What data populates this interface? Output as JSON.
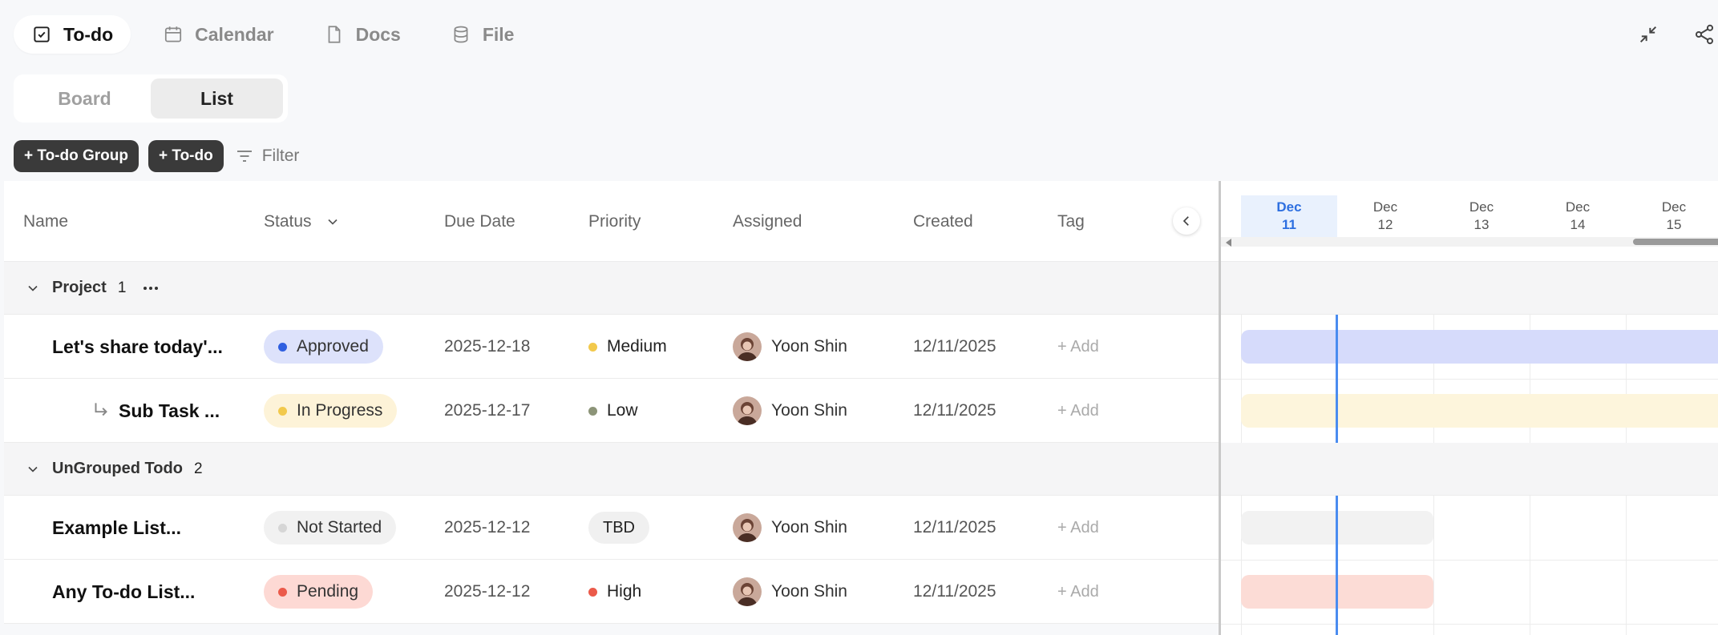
{
  "top_tabs": [
    {
      "label": "To-do",
      "icon": "checkbox-icon",
      "active": true
    },
    {
      "label": "Calendar",
      "icon": "calendar-icon",
      "active": false
    },
    {
      "label": "Docs",
      "icon": "document-icon",
      "active": false
    },
    {
      "label": "File",
      "icon": "database-icon",
      "active": false
    }
  ],
  "top_actions": [
    {
      "icon": "minimize-icon"
    },
    {
      "icon": "share-icon"
    }
  ],
  "view_toggle": {
    "board": "Board",
    "list": "List",
    "active": "List"
  },
  "toolbar": {
    "add_group": "+ To-do Group",
    "add_todo": "+ To-do",
    "filter": "Filter"
  },
  "columns": {
    "name": "Name",
    "status": "Status",
    "due_date": "Due Date",
    "priority": "Priority",
    "assigned": "Assigned",
    "created": "Created",
    "tag": "Tag"
  },
  "groups": [
    {
      "name": "Project",
      "count": "1",
      "rows": [
        {
          "name": "Let's share today'...",
          "subtask": false,
          "status": "Approved",
          "status_dot": "#2f5fe0",
          "status_bg": "#dde2fb",
          "due": "2025-12-18",
          "priority": "Medium",
          "priority_dot": "#f2c94c",
          "priority_style": "dot",
          "assignee": "Yoon Shin",
          "created": "12/11/2025",
          "tag": "+ Add"
        },
        {
          "name": "Sub Task ...",
          "subtask": true,
          "status": "In Progress",
          "status_dot": "#f2c94c",
          "status_bg": "#fdf3d8",
          "due": "2025-12-17",
          "priority": "Low",
          "priority_dot": "#8c9478",
          "priority_style": "dot",
          "assignee": "Yoon Shin",
          "created": "12/11/2025",
          "tag": "+ Add"
        }
      ]
    },
    {
      "name": "UnGrouped Todo",
      "count": "2",
      "rows": [
        {
          "name": "Example List...",
          "subtask": false,
          "status": "Not Started",
          "status_dot": "#d6d6d6",
          "status_bg": "#f1f1f1",
          "due": "2025-12-12",
          "priority": "TBD",
          "priority_dot": "",
          "priority_style": "pill",
          "assignee": "Yoon Shin",
          "created": "12/11/2025",
          "tag": "+ Add"
        },
        {
          "name": "Any To-do List...",
          "subtask": false,
          "status": "Pending",
          "status_dot": "#eb5a4a",
          "status_bg": "#fdd9d4",
          "due": "2025-12-12",
          "priority": "High",
          "priority_dot": "#eb5a4a",
          "priority_style": "dot",
          "assignee": "Yoon Shin",
          "created": "12/11/2025",
          "tag": "+ Add"
        }
      ]
    }
  ],
  "gantt": {
    "days": [
      {
        "month": "Dec",
        "day": "11",
        "today": true
      },
      {
        "month": "Dec",
        "day": "12",
        "today": false
      },
      {
        "month": "Dec",
        "day": "13",
        "today": false
      },
      {
        "month": "Dec",
        "day": "14",
        "today": false
      },
      {
        "month": "Dec",
        "day": "15",
        "today": false
      }
    ],
    "bars": [
      {
        "row": "Let's share today'...",
        "start_day": "11",
        "end_day": "18",
        "color": "#d6dbfb"
      },
      {
        "row": "Sub Task ...",
        "start_day": "11",
        "end_day": "17",
        "color": "#fdf5dc"
      },
      {
        "row": "Example List...",
        "start_day": "11",
        "end_day": "12",
        "color": "#f2f2f2"
      },
      {
        "row": "Any To-do List...",
        "start_day": "11",
        "end_day": "12",
        "color": "#fcdcd6"
      }
    ]
  },
  "colors": {
    "accent_today": "#4a8cf0",
    "dark_button": "#3a3a3a"
  }
}
